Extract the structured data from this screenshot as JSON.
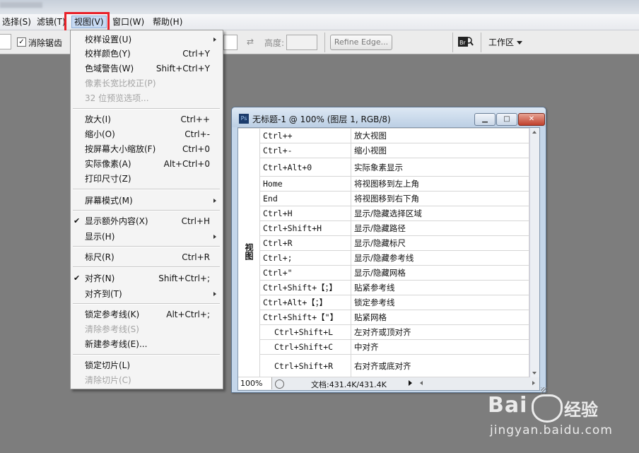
{
  "menubar": {
    "items": [
      {
        "label": "选择(S)"
      },
      {
        "label": "滤镜(T)"
      },
      {
        "label": "视图(V)",
        "active": true
      },
      {
        "label": "窗口(W)"
      },
      {
        "label": "帮助(H)"
      }
    ]
  },
  "options": {
    "antialias_label": "消除锯齿",
    "antialias_checked": true,
    "height_label": "高度:",
    "refine_edge_label": "Refine Edge...",
    "workspace_label": "工作区"
  },
  "view_menu": {
    "items": [
      {
        "label": "校样设置(U)",
        "shortcut": "",
        "submenu": true
      },
      {
        "label": "校样颜色(Y)",
        "shortcut": "Ctrl+Y"
      },
      {
        "label": "色域警告(W)",
        "shortcut": "Shift+Ctrl+Y"
      },
      {
        "label": "像素长宽比校正(P)",
        "shortcut": "",
        "disabled": true
      },
      {
        "label": "32 位预览选项...",
        "shortcut": "",
        "disabled": true
      },
      {
        "label": "放大(I)",
        "shortcut": "Ctrl++"
      },
      {
        "label": "缩小(O)",
        "shortcut": "Ctrl+-"
      },
      {
        "label": "按屏幕大小缩放(F)",
        "shortcut": "Ctrl+0"
      },
      {
        "label": "实际像素(A)",
        "shortcut": "Alt+Ctrl+0"
      },
      {
        "label": "打印尺寸(Z)",
        "shortcut": ""
      },
      {
        "label": "屏幕模式(M)",
        "shortcut": "",
        "submenu": true
      },
      {
        "label": "显示额外内容(X)",
        "shortcut": "Ctrl+H",
        "checked": true
      },
      {
        "label": "显示(H)",
        "shortcut": "",
        "submenu": true
      },
      {
        "label": "标尺(R)",
        "shortcut": "Ctrl+R"
      },
      {
        "label": "对齐(N)",
        "shortcut": "Shift+Ctrl+;",
        "checked": true
      },
      {
        "label": "对齐到(T)",
        "shortcut": "",
        "submenu": true
      },
      {
        "label": "锁定参考线(K)",
        "shortcut": "Alt+Ctrl+;"
      },
      {
        "label": "清除参考线(S)",
        "shortcut": "",
        "disabled": true
      },
      {
        "label": "新建参考线(E)...",
        "shortcut": ""
      },
      {
        "label": "锁定切片(L)",
        "shortcut": ""
      },
      {
        "label": "清除切片(C)",
        "shortcut": "",
        "disabled": true
      }
    ]
  },
  "document": {
    "title": "无标题-1 @ 100% (图层 1, RGB/8)",
    "category_label": "视图",
    "rows": [
      {
        "key": "Ctrl++",
        "desc": "放大视图"
      },
      {
        "key": "Ctrl+-",
        "desc": "缩小视图"
      },
      {
        "key": "Ctrl+Alt+0",
        "desc": "实际象素显示"
      },
      {
        "key": "Home",
        "desc": "将视图移到左上角"
      },
      {
        "key": "End",
        "desc": "将视图移到右下角"
      },
      {
        "key": "Ctrl+H",
        "desc": "显示/隐藏选择区域"
      },
      {
        "key": "Ctrl+Shift+H",
        "desc": "显示/隐藏路径"
      },
      {
        "key": "Ctrl+R",
        "desc": "显示/隐藏标尺"
      },
      {
        "key": "Ctrl+;",
        "desc": "显示/隐藏参考线"
      },
      {
        "key": "Ctrl+\"",
        "desc": "显示/隐藏网格"
      },
      {
        "key": "Ctrl+Shift+【；】",
        "desc": "贴紧参考线"
      },
      {
        "key": "Ctrl+Alt+【；】",
        "desc": "锁定参考线"
      },
      {
        "key": "Ctrl+Shift+【\"】",
        "desc": "贴紧网格"
      },
      {
        "key": "Ctrl+Shift+L",
        "desc": "左对齐或顶对齐"
      },
      {
        "key": "Ctrl+Shift+C",
        "desc": "中对齐"
      },
      {
        "key": "Ctrl+Shift+R",
        "desc": "右对齐或底对齐"
      }
    ],
    "zoom": "100%",
    "doc_size": "文档:431.4K/431.4K"
  },
  "watermark": {
    "logo": "Bai",
    "logo_tail": "经验",
    "url": "jingyan.baidu.com"
  }
}
